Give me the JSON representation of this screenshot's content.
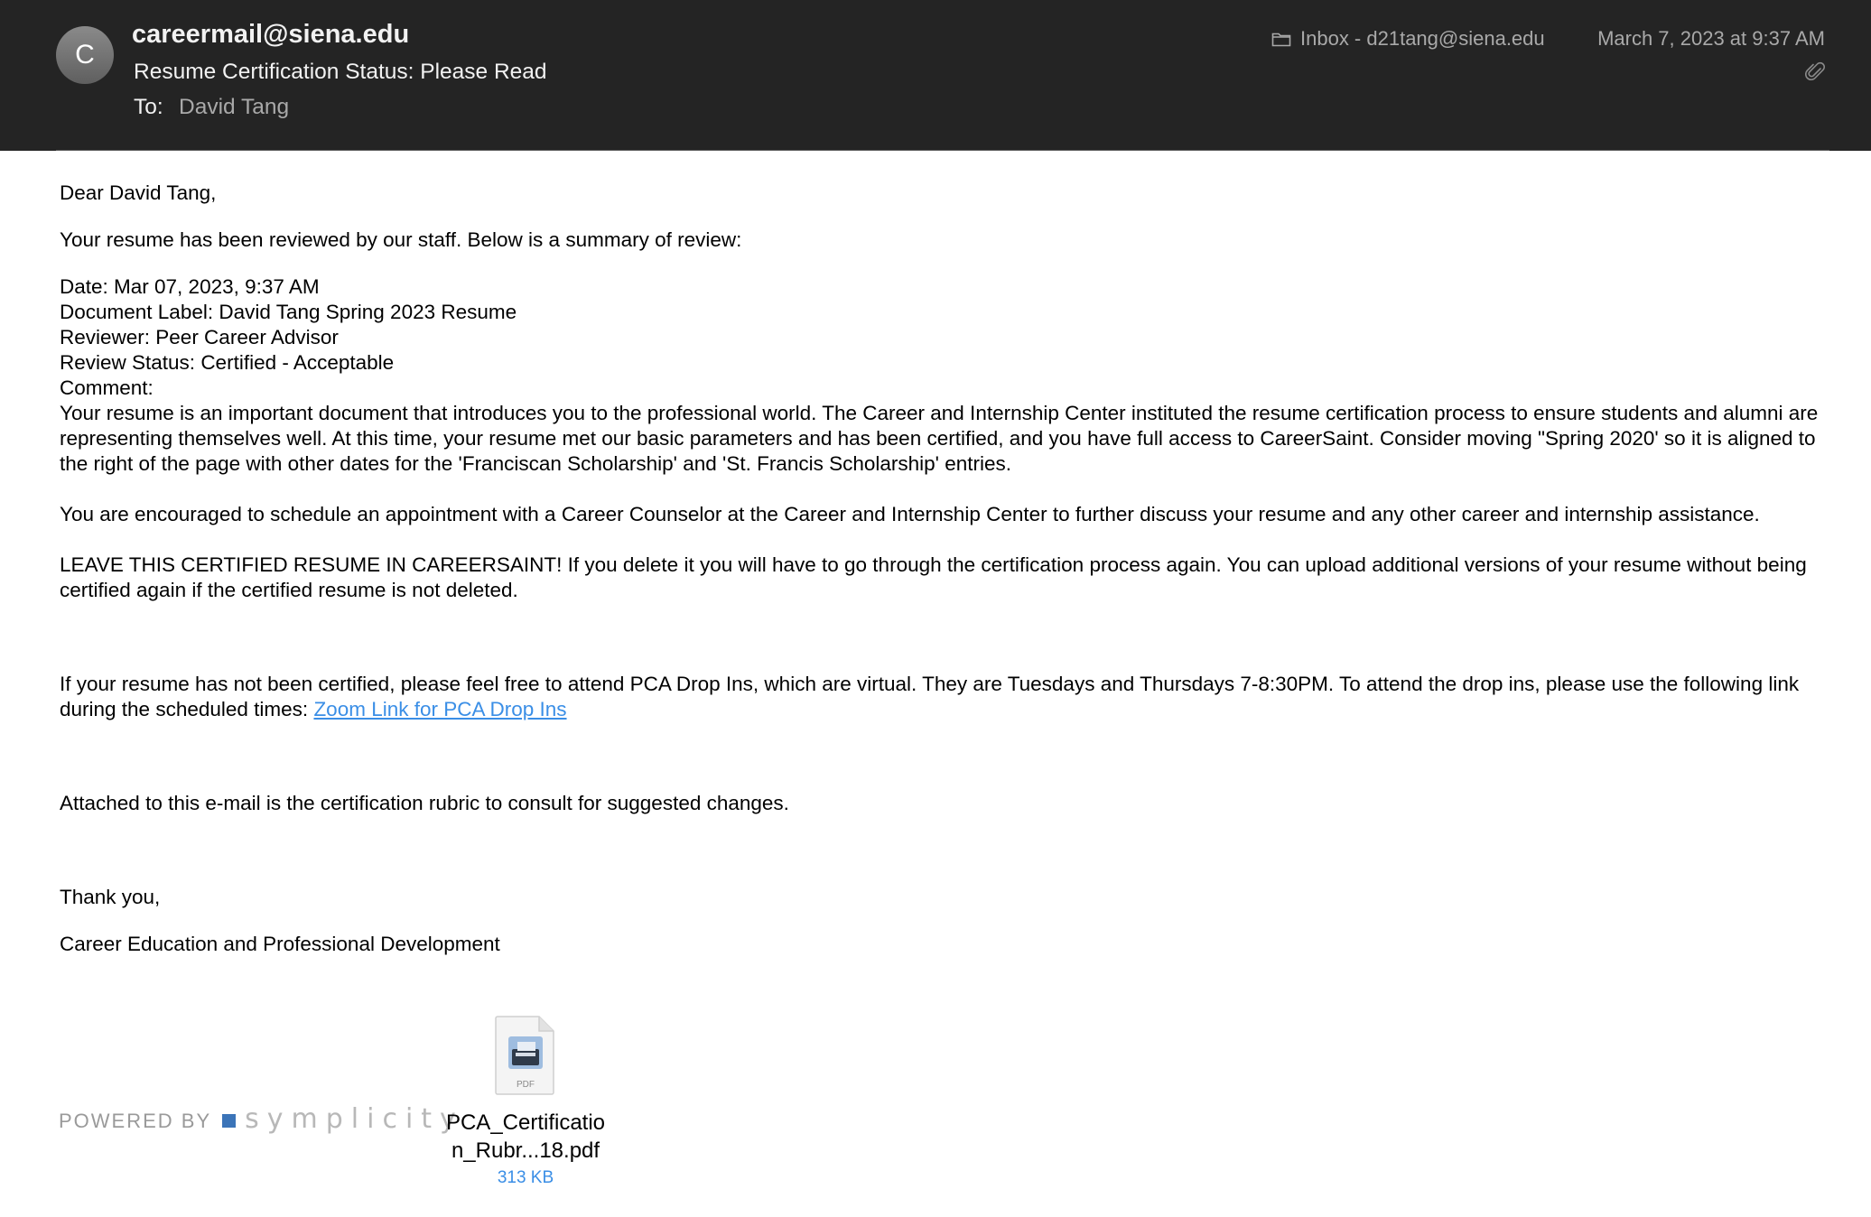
{
  "header": {
    "avatar_initial": "C",
    "sender": "careermail@siena.edu",
    "subject": "Resume Certification Status: Please Read",
    "to_label": "To:",
    "to_value": "David Tang",
    "mailbox": "Inbox - d21tang@siena.edu",
    "date": "March 7, 2023 at 9:37 AM"
  },
  "message": {
    "greeting": "Dear David Tang,",
    "intro": "Your resume has been reviewed by our staff. Below is a summary of review:",
    "date_line": "Date: Mar 07, 2023, 9:37 AM",
    "document_line": "Document Label: David Tang Spring 2023 Resume",
    "reviewer_line": "Reviewer: Peer Career Advisor",
    "status_line": "Review Status: Certified - Acceptable",
    "comment_label": "Comment:",
    "comment_text": "Your resume is an important document that introduces you to the professional world. The Career and Internship Center instituted the resume certification process to ensure students and alumni are representing themselves well. At this time, your resume met our basic parameters and has been certified, and you have full access to CareerSaint. Consider moving \"Spring 2020' so it is aligned to the right of the page with other dates for the 'Franciscan Scholarship' and 'St. Francis Scholarship' entries.",
    "encourage": "You are encouraged to schedule an appointment with a Career Counselor at the Career and Internship Center to further discuss your resume and any other career and internship assistance.",
    "leave_notice": "LEAVE THIS CERTIFIED RESUME IN CAREERSAINT! If you delete it you will have to go through the certification process again. You can upload additional versions of your resume without being certified again if the certified resume is not deleted.",
    "dropins_text": "If your resume has not been certified, please feel free to attend PCA Drop Ins, which are virtual. They are Tuesdays and Thursdays 7-8:30PM. To attend the drop ins, please use the following link during the scheduled times:",
    "dropins_link": "Zoom Link for PCA Drop Ins",
    "attached_note": "Attached to this e-mail is the certification rubric to consult for suggested changes.",
    "thanks": "Thank you,",
    "signature": "Career Education and Professional Development"
  },
  "footer": {
    "powered_label": "POWERED BY",
    "brand": "symplicity",
    "brand_color": "#3b74b8"
  },
  "attachment": {
    "icon": "pdf-file-icon",
    "icon_label": "PDF",
    "name_line1": "PCA_Certificatio",
    "name_line2": "n_Rubr...18.pdf",
    "size": "313 KB"
  },
  "colors": {
    "header_bg": "#242424",
    "link": "#3a8ee6",
    "muted": "#a9a9a9"
  }
}
